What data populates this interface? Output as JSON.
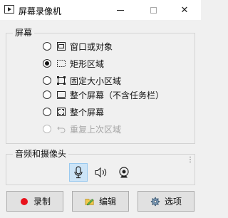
{
  "window": {
    "title": "屏幕录像机",
    "minimize_glyph": "—",
    "maximize_glyph": "☐",
    "close_glyph": "✕"
  },
  "screen_group": {
    "label": "屏幕",
    "selected_index": 1,
    "options": [
      {
        "label": "窗口或对象",
        "icon": "window-icon",
        "enabled": true
      },
      {
        "label": "矩形区域",
        "icon": "rectangle-region-icon",
        "enabled": true
      },
      {
        "label": "固定大小区域",
        "icon": "fixed-size-region-icon",
        "enabled": true
      },
      {
        "label": "整个屏幕（不含任务栏）",
        "icon": "screen-no-taskbar-icon",
        "enabled": true
      },
      {
        "label": "整个屏幕",
        "icon": "fullscreen-icon",
        "enabled": true
      },
      {
        "label": "重复上次区域",
        "icon": "repeat-region-icon",
        "enabled": false
      }
    ]
  },
  "av_group": {
    "label": "音频和摄像头",
    "mic_selected": true,
    "icons": [
      "microphone-icon",
      "speaker-icon",
      "webcam-icon"
    ]
  },
  "buttons": {
    "record": "录制",
    "edit": "编辑",
    "options": "选项"
  },
  "colors": {
    "record_dot": "#e8111b",
    "selected_highlight": "#cce4f7"
  }
}
